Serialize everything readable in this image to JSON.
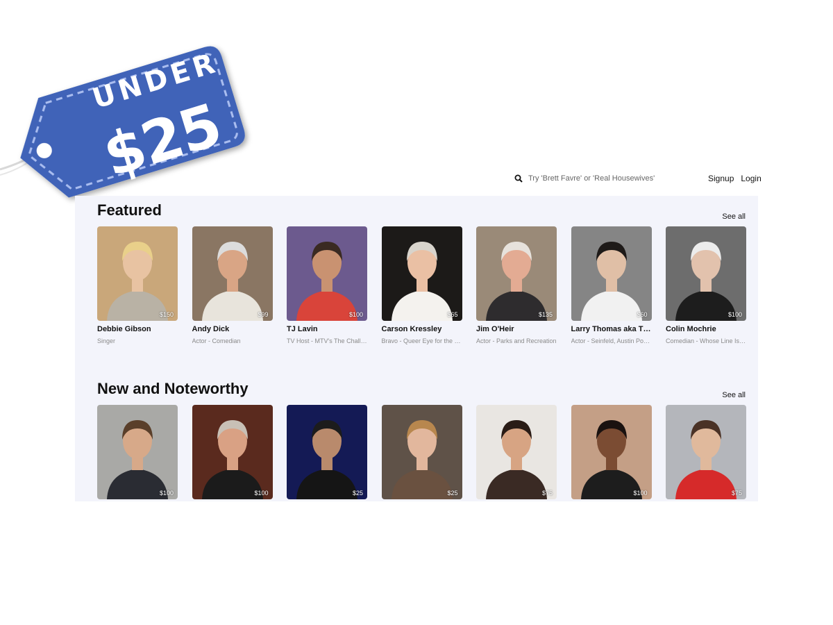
{
  "tag": {
    "line1": "UNDER",
    "line2": "$25",
    "color": "#3f63b8"
  },
  "search": {
    "placeholder": "Try 'Brett Favre' or 'Real Housewives'"
  },
  "nav": {
    "signup": "Signup",
    "login": "Login"
  },
  "featured": {
    "title": "Featured",
    "see_all": "See all",
    "cards": [
      {
        "name": "Debbie Gibson",
        "desc": "Singer",
        "price": "$150",
        "bg": "#c9a77a",
        "skin": "#e8c3a2",
        "hair": "#e9d08a",
        "shirt": "#b9b2a5"
      },
      {
        "name": "Andy Dick",
        "desc": "Actor - Comedian",
        "price": "$99",
        "bg": "#8a7663",
        "skin": "#d9a585",
        "hair": "#dcdcdc",
        "shirt": "#e8e4dc"
      },
      {
        "name": "TJ Lavin",
        "desc": "TV Host - MTV's The Challenge",
        "price": "$100",
        "bg": "#6c5a8e",
        "skin": "#c99271",
        "hair": "#3a2a22",
        "shirt": "#d9443a"
      },
      {
        "name": "Carson Kressley",
        "desc": "Bravo - Queer Eye for the Straight Guy",
        "price": "$65",
        "bg": "#1c1a18",
        "skin": "#eac0a4",
        "hair": "#d8d4cc",
        "shirt": "#f4f2ee"
      },
      {
        "name": "Jim O'Heir",
        "desc": "Actor - Parks and Recreation",
        "price": "$135",
        "bg": "#9a8a78",
        "skin": "#e3ab93",
        "hair": "#e7e2dc",
        "shirt": "#2e2c2e"
      },
      {
        "name": "Larry Thomas aka The Soup Nazi",
        "desc": "Actor - Seinfeld, Austin Powers",
        "price": "$60",
        "bg": "#858585",
        "skin": "#e0bfa6",
        "hair": "#1e1a18",
        "shirt": "#f1f1f1"
      },
      {
        "name": "Colin Mochrie",
        "desc": "Comedian - Whose Line Is It Anyway",
        "price": "$100",
        "bg": "#6d6d6d",
        "skin": "#e2c2ad",
        "hair": "#ececec",
        "shirt": "#1d1d1d"
      }
    ]
  },
  "noteworthy": {
    "title": "New and Noteworthy",
    "see_all": "See all",
    "cards": [
      {
        "price": "$100",
        "bg": "#a9a9a6",
        "skin": "#d7a989",
        "hair": "#5a3f2a",
        "shirt": "#2a2c33"
      },
      {
        "price": "$100",
        "bg": "#5a2a1e",
        "skin": "#d9a184",
        "hair": "#c8c0b6",
        "shirt": "#1b1b1b"
      },
      {
        "price": "$25",
        "bg": "#141a55",
        "skin": "#b98a6c",
        "hair": "#1c1c1c",
        "shirt": "#151515"
      },
      {
        "price": "$25",
        "bg": "#5f5248",
        "skin": "#e2b79d",
        "hair": "#b8874e",
        "shirt": "#6a5140"
      },
      {
        "price": "$75",
        "bg": "#e9e6e2",
        "skin": "#d7a483",
        "hair": "#2a1c16",
        "shirt": "#3a2a24"
      },
      {
        "price": "$100",
        "bg": "#c49f86",
        "skin": "#7b4c33",
        "hair": "#1a1210",
        "shirt": "#1d1d1d"
      },
      {
        "price": "$75",
        "bg": "#b4b6bb",
        "skin": "#e0b99c",
        "hair": "#4a3226",
        "shirt": "#d62a2a"
      }
    ]
  }
}
